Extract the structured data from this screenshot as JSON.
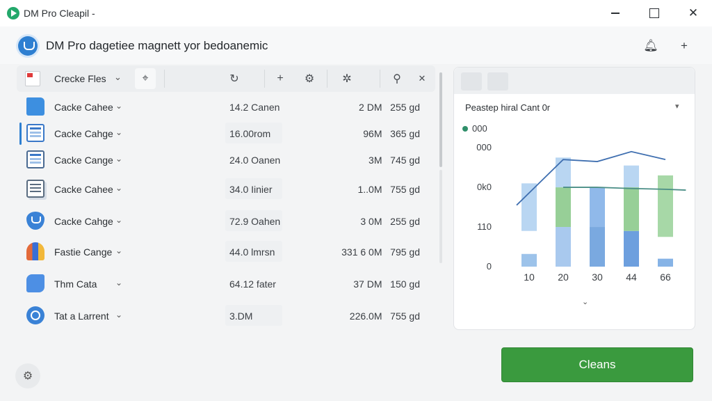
{
  "window": {
    "title": "DM Pro Cleapil -",
    "close_glyph": "✕"
  },
  "header": {
    "title": "DM Pro dagetiee magnett yor bedoanemic"
  },
  "toolbar": {
    "label": "Crecke Fles"
  },
  "rows": [
    {
      "name": "Cacke Cahee",
      "size": "14.2 Canen",
      "value1": "2 DM",
      "value2": "255 gd",
      "icon": "folder-icon"
    },
    {
      "name": "Cacke Cahge",
      "size": "16.00rom",
      "value1": "96M",
      "value2": "365 gd",
      "icon": "document-icon",
      "active": true
    },
    {
      "name": "Cacke Cange",
      "size": "24.0 Oanen",
      "value1": "3M",
      "value2": "745 gd",
      "icon": "window-icon"
    },
    {
      "name": "Cacke Cahee",
      "size": "34.0 Iinier",
      "value1": "1..0M",
      "value2": "755 gd",
      "icon": "documents-icon"
    },
    {
      "name": "Cacke Cahge",
      "size": "72.9 Oahen",
      "value1": "3 0M",
      "value2": "255 gd",
      "icon": "shield-icon"
    },
    {
      "name": "Fastie Cange",
      "size": "44.0 lmrsn",
      "value1": "331 6 0M",
      "value2": "795 gd",
      "icon": "people-icon"
    },
    {
      "name": "Thm Cata",
      "size": "64.12 fater",
      "value1": "37 DM",
      "value2": "150 gd",
      "icon": "hand-icon"
    },
    {
      "name": "Tat a Larrent",
      "size": "3.DM",
      "value1": "226.0M",
      "value2": "755 gd",
      "icon": "chat-icon"
    }
  ],
  "chart_panel": {
    "title": "Peastep hiral Cant 0r",
    "legend_label": "000"
  },
  "chart_data": {
    "type": "bar",
    "categories": [
      "10",
      "20",
      "30",
      "44",
      "66"
    ],
    "ytick_labels": [
      "000",
      "0k0",
      "110",
      "0"
    ],
    "ytick_values": [
      300,
      200,
      100,
      0
    ],
    "ylim": [
      0,
      330
    ],
    "bars": [
      {
        "category": "10",
        "segments": [
          {
            "from": 0,
            "to": 32,
            "color": "#9dc3ea"
          },
          {
            "from": 90,
            "to": 210,
            "color": "#b9d6f2"
          }
        ]
      },
      {
        "category": "20",
        "segments": [
          {
            "from": 0,
            "to": 100,
            "color": "#a9c9ee"
          },
          {
            "from": 100,
            "to": 200,
            "color": "#97cf97"
          },
          {
            "from": 200,
            "to": 275,
            "color": "#b9d6f2"
          }
        ]
      },
      {
        "category": "30",
        "segments": [
          {
            "from": 0,
            "to": 100,
            "color": "#7aa9e0"
          },
          {
            "from": 100,
            "to": 200,
            "color": "#90b9ea"
          }
        ]
      },
      {
        "category": "44",
        "segments": [
          {
            "from": 0,
            "to": 90,
            "color": "#6d9fde"
          },
          {
            "from": 90,
            "to": 200,
            "color": "#97cf97"
          },
          {
            "from": 200,
            "to": 255,
            "color": "#b9d6f2"
          }
        ]
      },
      {
        "category": "66",
        "segments": [
          {
            "from": 0,
            "to": 20,
            "color": "#86b3e6"
          },
          {
            "from": 75,
            "to": 230,
            "color": "#a7d8a7"
          }
        ]
      }
    ],
    "series": [
      {
        "color": "#3f6fb0",
        "points": [
          [
            0,
            155
          ],
          [
            1,
            270
          ],
          [
            2,
            265
          ],
          [
            3,
            290
          ],
          [
            4,
            270
          ]
        ]
      },
      {
        "color": "#4a8e86",
        "points": [
          [
            1,
            200
          ],
          [
            2,
            200
          ],
          [
            3,
            197
          ],
          [
            4,
            195
          ],
          [
            4.6,
            193
          ]
        ]
      }
    ],
    "grid": false
  },
  "actions": {
    "clean_label": "Cleans"
  }
}
